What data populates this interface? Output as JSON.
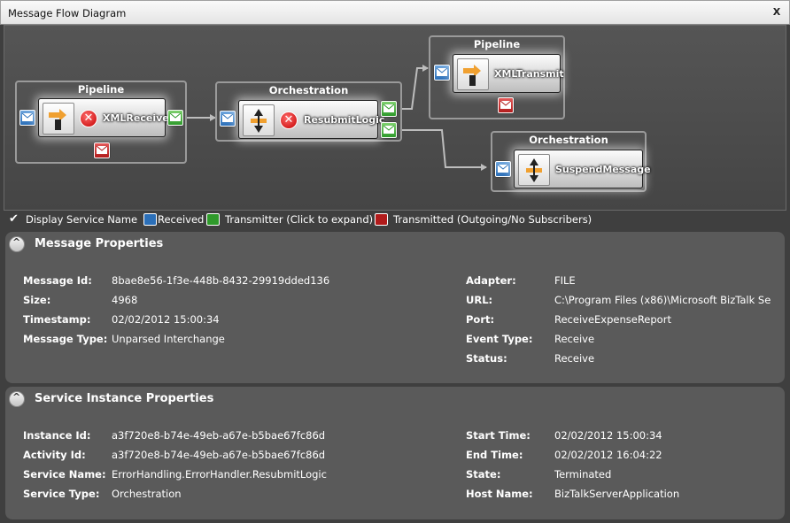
{
  "window": {
    "title": "Message Flow Diagram",
    "close_label": "X"
  },
  "diagram": {
    "groups": [
      {
        "title": "Pipeline",
        "node_label": "XMLReceive",
        "status": "error"
      },
      {
        "title": "Orchestration",
        "node_label": "ResubmitLogic",
        "status": "error"
      },
      {
        "title": "Pipeline",
        "node_label": "XMLTransmit",
        "status": "ok"
      },
      {
        "title": "Orchestration",
        "node_label": "SuspendMessage",
        "status": "ok"
      }
    ],
    "colors": {
      "received": "#2b6fb8",
      "transmitter": "#2f9a2b",
      "transmitted": "#b11b1b"
    }
  },
  "legend": {
    "display_service_name": "Display Service Name",
    "received": "Received",
    "transmitter": "Transmitter (Click to expand)",
    "transmitted": "Transmitted (Outgoing/No Subscribers)"
  },
  "message_properties": {
    "title": "Message Properties",
    "left": [
      {
        "label": "Message Id:",
        "value": "8bae8e56-1f3e-448b-8432-29919dded136"
      },
      {
        "label": "Size:",
        "value": "4968"
      },
      {
        "label": "Timestamp:",
        "value": "02/02/2012 15:00:34"
      },
      {
        "label": "Message Type:",
        "value": "Unparsed Interchange"
      }
    ],
    "right": [
      {
        "label": "Adapter:",
        "value": "FILE"
      },
      {
        "label": "URL:",
        "value": "C:\\Program Files (x86)\\Microsoft BizTalk Se"
      },
      {
        "label": "Port:",
        "value": "ReceiveExpenseReport"
      },
      {
        "label": "Event Type:",
        "value": "Receive"
      },
      {
        "label": "Status:",
        "value": "Receive"
      }
    ]
  },
  "service_properties": {
    "title": "Service Instance Properties",
    "left": [
      {
        "label": "Instance Id:",
        "value": "a3f720e8-b74e-49eb-a67e-b5bae67fc86d"
      },
      {
        "label": "Activity Id:",
        "value": "a3f720e8-b74e-49eb-a67e-b5bae67fc86d"
      },
      {
        "label": "Service Name:",
        "value": "ErrorHandling.ErrorHandler.ResubmitLogic"
      },
      {
        "label": "Service Type:",
        "value": "Orchestration"
      }
    ],
    "right": [
      {
        "label": "Start Time:",
        "value": "02/02/2012 15:00:34"
      },
      {
        "label": "End Time:",
        "value": "02/02/2012 16:04:22"
      },
      {
        "label": "State:",
        "value": "Terminated"
      },
      {
        "label": "Host Name:",
        "value": "BizTalkServerApplication"
      }
    ]
  }
}
